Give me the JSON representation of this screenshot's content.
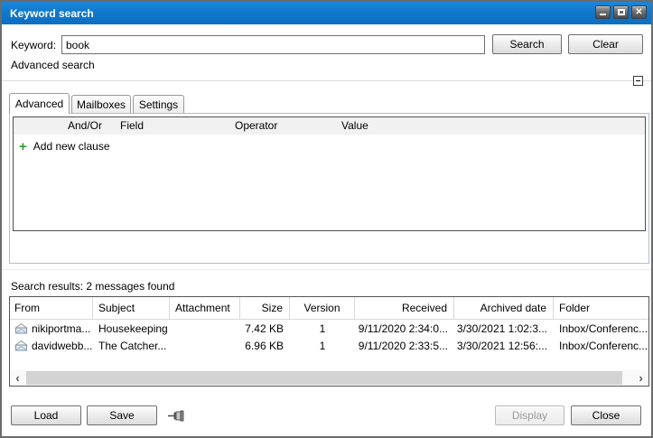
{
  "window": {
    "title": "Keyword search"
  },
  "icons": {
    "close": "✕",
    "add_clause_plus": "+",
    "scroll_left": "‹",
    "scroll_right": "›"
  },
  "search_bar": {
    "keyword_label": "Keyword:",
    "keyword_value": "book",
    "search_button": "Search",
    "clear_button": "Clear",
    "advanced_search_label": "Advanced search"
  },
  "tabs": [
    {
      "label": "Advanced",
      "active": true
    },
    {
      "label": "Mailboxes",
      "active": false
    },
    {
      "label": "Settings",
      "active": false
    }
  ],
  "clause_table": {
    "headers": [
      "And/Or",
      "Field",
      "Operator",
      "Value"
    ],
    "add_new_clause_label": "Add new clause"
  },
  "results": {
    "summary": "Search results: 2 messages found",
    "headers": [
      "From",
      "Subject",
      "Attachment",
      "Size",
      "Version",
      "Received",
      "Archived date",
      "Folder"
    ],
    "rows": [
      {
        "from": "nikiportma...",
        "subject": "Housekeeping",
        "attachment": "",
        "size": "7.42 KB",
        "version": "1",
        "received": "9/11/2020 2:34:0...",
        "archived_date": "3/30/2021 1:02:3...",
        "folder": "Inbox/Conferenc..."
      },
      {
        "from": "davidwebb...",
        "subject": "The Catcher...",
        "attachment": "",
        "size": "6.96 KB",
        "version": "1",
        "received": "9/11/2020 2:33:5...",
        "archived_date": "3/30/2021 12:56:...",
        "folder": "Inbox/Conferenc..."
      }
    ]
  },
  "footer": {
    "load_button": "Load",
    "save_button": "Save",
    "display_button": "Display",
    "close_button": "Close"
  },
  "colors": {
    "titlebar_blue": "#0f79cd",
    "add_clause_green": "#2ba12b",
    "panel_border": "#a9bfd3"
  }
}
